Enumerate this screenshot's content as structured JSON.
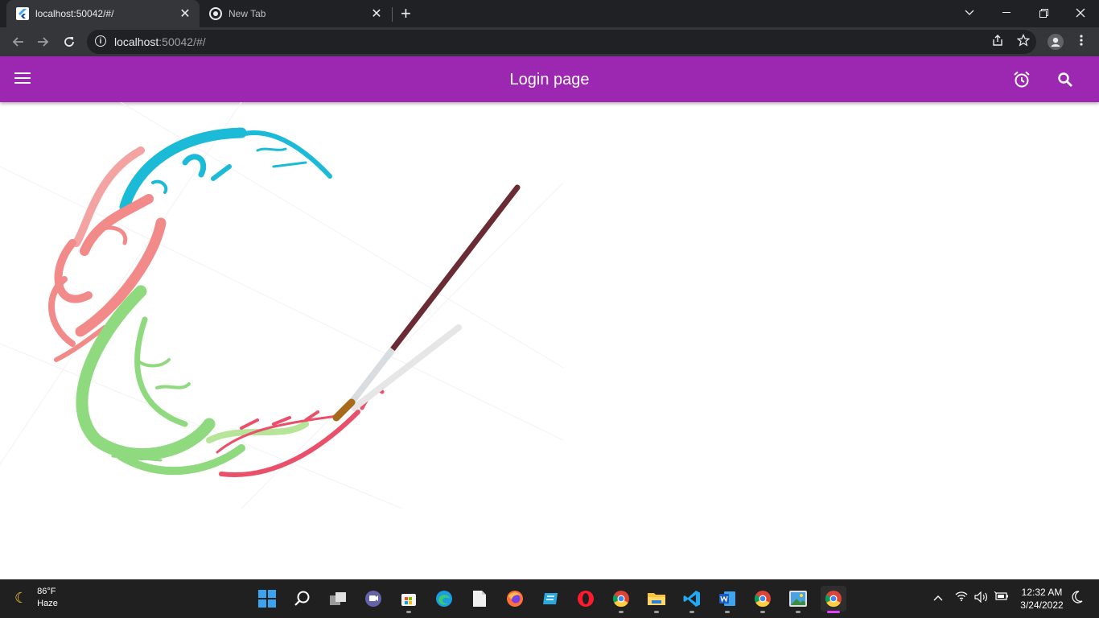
{
  "browser": {
    "tabs": [
      {
        "title": "localhost:50042/#/",
        "close": "✕"
      },
      {
        "title": "New Tab",
        "close": "✕"
      }
    ],
    "new_tab": "+",
    "address": {
      "host": "localhost",
      "rest": ":50042/#/"
    }
  },
  "app": {
    "title": "Login page",
    "accent": "#9c27b0",
    "icons": [
      "menu-icon",
      "alarm-icon",
      "search-icon"
    ]
  },
  "taskbar": {
    "weather": {
      "temp": "86°F",
      "condition": "Haze"
    },
    "clock": {
      "time": "12:32 AM",
      "date": "3/24/2022"
    },
    "apps": [
      "start",
      "search",
      "task-view",
      "teams-chat",
      "microsoft-store",
      "edge",
      "file",
      "firefox",
      "app",
      "opera",
      "chrome-dev",
      "file-explorer",
      "vscode",
      "word",
      "chrome-beta",
      "photos",
      "chrome"
    ]
  }
}
